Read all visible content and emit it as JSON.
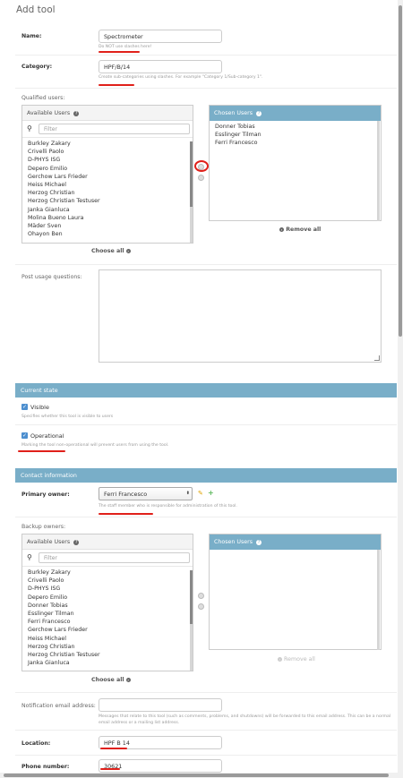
{
  "title": "Add tool",
  "name": {
    "label": "Name:",
    "value": "Spectrometer",
    "help": "Do NOT use slashes here!"
  },
  "category": {
    "label": "Category:",
    "value": "HPF/B/14",
    "help": "Create sub-categories using slashes. For example \"Category 1/Sub-category 1\"."
  },
  "qualified": {
    "label": "Qualified users:",
    "available_title": "Available Users",
    "filter_placeholder": "Filter",
    "available": [
      "Burkley Zakary",
      "Crivelli Paolo",
      "D-PHYS ISG",
      "Depero Emilio",
      "Gerchow Lars Frieder",
      "Heiss Michael",
      "Herzog Christian",
      "Herzog Christian Testuser",
      "Janka Gianluca",
      "Molina Bueno Laura",
      "Mäder Sven",
      "Ohayon Ben"
    ],
    "chosen_title": "Chosen Users",
    "chosen": [
      "Donner Tobias",
      "Esslinger Tilman",
      "Ferri Francesco"
    ],
    "choose_all": "Choose all",
    "remove_all": "Remove all"
  },
  "post_usage": {
    "label": "Post usage questions:"
  },
  "current_state": {
    "title": "Current state",
    "visible_label": "Visible",
    "visible_help": "Specifies whether this tool is visible to users",
    "operational_label": "Operational",
    "operational_help": "Marking the tool non-operational will prevent users from using the tool."
  },
  "contact": {
    "title": "Contact information",
    "primary_label": "Primary owner:",
    "primary_value": "Ferri Francesco",
    "primary_help": "The staff member who is responsible for administration of this tool."
  },
  "backup": {
    "label": "Backup owners:",
    "available_title": "Available Users",
    "filter_placeholder": "Filter",
    "available": [
      "Burkley Zakary",
      "Crivelli Paolo",
      "D-PHYS ISG",
      "Depero Emilio",
      "Donner Tobias",
      "Esslinger Tilman",
      "Ferri Francesco",
      "Gerchow Lars Frieder",
      "Heiss Michael",
      "Herzog Christian",
      "Herzog Christian Testuser",
      "Janka Gianluca"
    ],
    "chosen_title": "Chosen Users",
    "choose_all": "Choose all",
    "remove_all": "Remove all"
  },
  "notification": {
    "label": "Notification email address:",
    "help": "Messages that relate to this tool (such as comments, problems, and shutdowns) will be forwarded to this email address. This can be a normal email address or a mailing list address."
  },
  "location": {
    "label": "Location:",
    "value": "HPF B 14"
  },
  "phone": {
    "label": "Phone number:",
    "value": "30621"
  },
  "colors": {
    "accent": "#79aec8",
    "annotation": "#e0201a",
    "link": "#447e9b"
  }
}
